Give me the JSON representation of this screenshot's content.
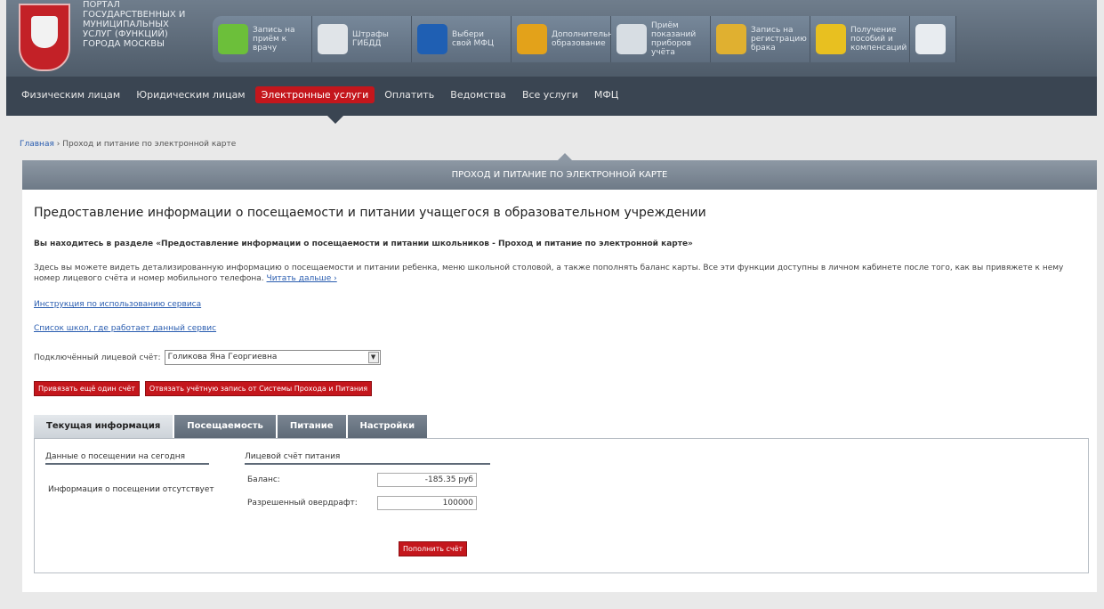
{
  "header": {
    "portal_title": "ПОРТАЛ ГОСУДАРСТВЕННЫХ И МУНИЦИПАЛЬНЫХ УСЛУГ (ФУНКЦИЙ) ГОРОДА МОСКВЫ",
    "services": [
      {
        "label": "Запись на приём к врачу",
        "icon": "medical-cross-icon",
        "color": "#6cbf3a"
      },
      {
        "label": "Штрафы ГИБДД",
        "icon": "traffic-fine-icon",
        "color": "#e0e4e8"
      },
      {
        "label": "Выбери свой МФЦ",
        "icon": "mfc-icon",
        "color": "#1f5fb3"
      },
      {
        "label": "Дополнительное образование",
        "icon": "education-icon",
        "color": "#e3a21a"
      },
      {
        "label": "Приём показаний приборов учёта",
        "icon": "meter-icon",
        "color": "#d7dde3"
      },
      {
        "label": "Запись на регистрацию брака",
        "icon": "rings-icon",
        "color": "#e0b030"
      },
      {
        "label": "Получение пособий и компенсаций",
        "icon": "benefits-icon",
        "color": "#e8c020"
      },
      {
        "label": "",
        "icon": "document-icon",
        "color": "#e8ecf0"
      }
    ]
  },
  "nav": {
    "items": [
      "Физическим лицам",
      "Юридическим лицам",
      "Электронные услуги",
      "Оплатить",
      "Ведомства",
      "Все услуги",
      "МФЦ"
    ],
    "active_index": 2,
    "active_color": "#c4161c"
  },
  "breadcrumb": {
    "home": "Главная",
    "separator": "›",
    "current": "Проход и питание по электронной карте"
  },
  "panel_title": "ПРОХОД И ПИТАНИЕ ПО ЭЛЕКТРОННОЙ КАРТЕ",
  "main": {
    "title": "Предоставление информации о посещаемости и питании учащегося в образовательном учреждении",
    "section_line": "Вы находитесь в разделе «Предоставление информации о посещаемости и питании школьников - Проход и питание по электронной карте»",
    "description": "Здесь вы можете видеть детализированную информацию о посещаемости и питании ребенка, меню школьной столовой, а также пополнять баланс карты. Все эти функции доступны в личном кабинете после того, как вы привяжете к нему номер лицевого счёта и номер мобильного телефона.",
    "read_more": "Читать дальше ›",
    "link_instructions": "Инструкция по использованию сервиса",
    "link_schools": "Список школ, где работает данный сервис",
    "account_label": "Подключённый лицевой счёт:",
    "account_value": "Голикова Яна Георгиевна",
    "btn_add_account": "Привязать ещё один счёт",
    "btn_unlink": "Отвязать учётную запись от Системы Прохода и Питания"
  },
  "tabs": [
    "Текущая информация",
    "Посещаемость",
    "Питание",
    "Настройки"
  ],
  "active_tab": 0,
  "current_info": {
    "visits_header": "Данные о посещении на сегодня",
    "visits_text": "Информация о посещении отсутствует",
    "account_header": "Лицевой счёт питания",
    "balance_label": "Баланс:",
    "balance_value": "-185.35 руб",
    "overdraft_label": "Разрешенный овердрафт:",
    "overdraft_value": "100000",
    "topup_button": "Пополнить счёт"
  }
}
